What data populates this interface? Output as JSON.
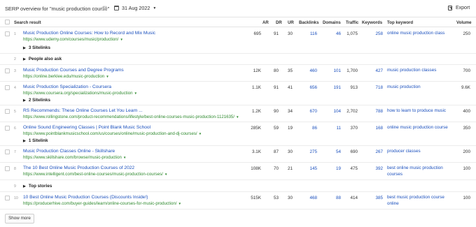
{
  "header": {
    "title": "SERP overview for \"music production course\"",
    "help_icon": "?",
    "date": "31 Aug 2022",
    "export_label": "Export"
  },
  "columns": {
    "search_result": "Search result",
    "ar": "AR",
    "dr": "DR",
    "ur": "UR",
    "backlinks": "Backlinks",
    "domains": "Domains",
    "traffic": "Traffic",
    "keywords": "Keywords",
    "top_keyword": "Top keyword",
    "volume": "Volume"
  },
  "rows": [
    {
      "pos": "1",
      "title": "Music Production Online Courses: How to Record and Mix Music",
      "url": "https://www.udemy.com/courses/music/production/",
      "ar": "695",
      "dr": "91",
      "ur": "30",
      "backlinks": "116",
      "domains": "46",
      "traffic": "1,075",
      "keywords": "258",
      "top_keyword": "online music production class",
      "volume": "250",
      "sitelinks": "3 Sitelinks"
    },
    {
      "pos": "2",
      "feature": "People also ask"
    },
    {
      "pos": "3",
      "title": "Music Production Courses and Degree Programs",
      "url": "https://online.berklee.edu/music-production",
      "ar": "12K",
      "dr": "80",
      "ur": "35",
      "backlinks": "460",
      "domains": "101",
      "traffic": "1,700",
      "keywords": "427",
      "top_keyword": "music production classes",
      "volume": "700"
    },
    {
      "pos": "4",
      "title": "Music Production Specialization - Coursera",
      "url": "https://www.coursera.org/specializations/music-production",
      "ar": "1.1K",
      "dr": "91",
      "ur": "41",
      "backlinks": "656",
      "domains": "191",
      "traffic": "913",
      "keywords": "718",
      "top_keyword": "music production",
      "volume": "9.6K",
      "sitelinks": "2 Sitelinks"
    },
    {
      "pos": "5",
      "title": "RS Recommends: These Online Courses Let You Learn ...",
      "url": "https://www.rollingstone.com/product-recommendations/lifestyle/best-online-courses-music-production-1121635/",
      "ar": "1.2K",
      "dr": "90",
      "ur": "34",
      "backlinks": "670",
      "domains": "104",
      "traffic": "2,702",
      "keywords": "788",
      "top_keyword": "how to learn to produce music",
      "volume": "400"
    },
    {
      "pos": "6",
      "title": "Online Sound Engineering Classes | Point Blank Music School",
      "url": "https://www.pointblankmusicschool.com/us/courses/online/music-production-and-dj-courses/",
      "ar": "285K",
      "dr": "59",
      "ur": "19",
      "backlinks": "86",
      "domains": "11",
      "traffic": "370",
      "keywords": "168",
      "top_keyword": "online music production course",
      "volume": "350",
      "sitelinks": "1 Sitelink"
    },
    {
      "pos": "7",
      "title": "Music Production Classes Online - Skillshare",
      "url": "https://www.skillshare.com/browse/music-production",
      "ar": "3.1K",
      "dr": "87",
      "ur": "30",
      "backlinks": "275",
      "domains": "54",
      "traffic": "690",
      "keywords": "267",
      "top_keyword": "producer classes",
      "volume": "200"
    },
    {
      "pos": "8",
      "title": "The 10 Best Online Music Production Courses of 2022",
      "url": "https://www.intelligent.com/best-online-courses/music-production-courses/",
      "ar": "108K",
      "dr": "70",
      "ur": "21",
      "backlinks": "145",
      "domains": "19",
      "traffic": "475",
      "keywords": "392",
      "top_keyword": "best online music production courses",
      "volume": "100"
    },
    {
      "pos": "9",
      "feature": "Top stories"
    },
    {
      "pos": "10",
      "title": "10 Best Online Music Production Courses (Discounts Inside!)",
      "url": "https://producerhive.com/buyer-guides/learn/online-courses-for-music-production/",
      "ar": "515K",
      "dr": "53",
      "ur": "30",
      "backlinks": "468",
      "domains": "88",
      "traffic": "414",
      "keywords": "385",
      "top_keyword": "best music production course online",
      "volume": "100"
    }
  ],
  "footer": {
    "show_more": "Show more"
  },
  "colors": {
    "link": "#1a4fbd",
    "url": "#2f8a2f",
    "border": "#e4e4e4"
  }
}
